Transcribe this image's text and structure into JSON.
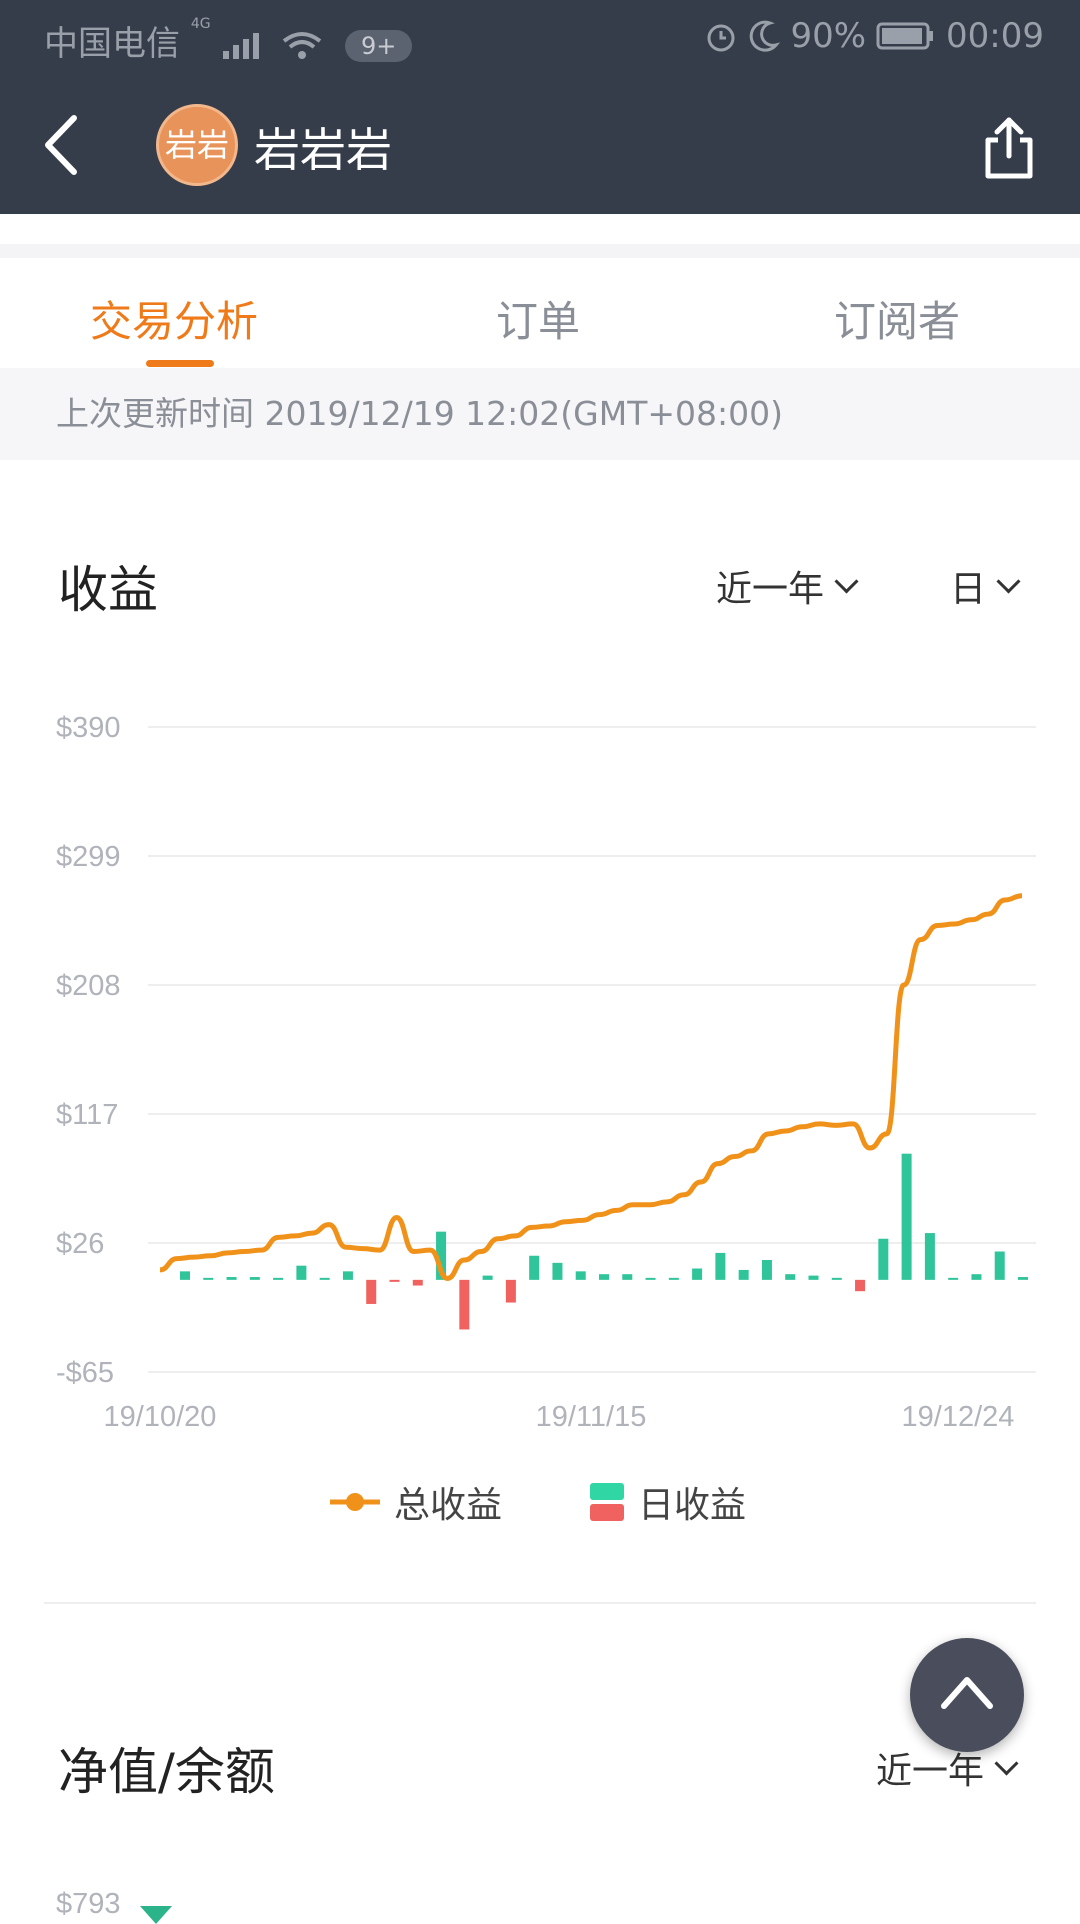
{
  "status_bar": {
    "carrier": "中国电信",
    "network": "4G",
    "notif_badge": "9+",
    "battery": "90%",
    "time": "00:09"
  },
  "header": {
    "avatar_text": "岩岩",
    "title": "岩岩岩"
  },
  "tabs": [
    {
      "label": "交易分析",
      "active": true
    },
    {
      "label": "订单",
      "active": false
    },
    {
      "label": "订阅者",
      "active": false
    }
  ],
  "last_updated": "上次更新时间 2019/12/19 12:02(GMT+08:00)",
  "earnings": {
    "title": "收益",
    "range_select": "近一年",
    "interval_select": "日"
  },
  "chart_data": {
    "type": "line",
    "title": "",
    "xlabel": "",
    "ylabel": "",
    "y_ticks": [
      "$390",
      "$299",
      "$208",
      "$117",
      "$26",
      "-$65"
    ],
    "x_ticks": [
      "19/10/20",
      "19/11/15",
      "19/12/24"
    ],
    "ylim": [
      -65,
      390
    ],
    "grid": true,
    "legend": "bottom",
    "series": [
      {
        "name": "总收益",
        "kind": "line",
        "color": "#f0921a",
        "values": [
          7,
          15,
          16,
          17,
          19,
          20,
          21,
          30,
          31,
          33,
          39,
          23,
          22,
          21,
          44,
          20,
          21,
          1,
          14,
          20,
          29,
          31,
          37,
          38,
          41,
          42,
          46,
          49,
          53,
          53,
          55,
          60,
          69,
          82,
          87,
          91,
          103,
          105,
          108,
          110,
          109,
          110,
          93,
          103,
          208,
          240,
          250,
          251,
          254,
          258,
          268,
          271
        ]
      },
      {
        "name": "日收益",
        "kind": "bar",
        "positive_color": "#30c49a",
        "negative_color": "#f0625f",
        "values": [
          6,
          1,
          2,
          2,
          1,
          10,
          1,
          6,
          -17,
          -1,
          -4,
          34,
          -35,
          3,
          -16,
          17,
          12,
          6,
          4,
          4,
          1,
          1,
          8,
          19,
          7,
          14,
          4,
          3,
          1,
          -8,
          29,
          89,
          33,
          1,
          4,
          20,
          2
        ]
      }
    ]
  },
  "legend": {
    "total_label": "总收益",
    "daily_label": "日收益"
  },
  "networth": {
    "title": "净值/余额",
    "range_select": "近一年",
    "first_tick": "$793"
  }
}
